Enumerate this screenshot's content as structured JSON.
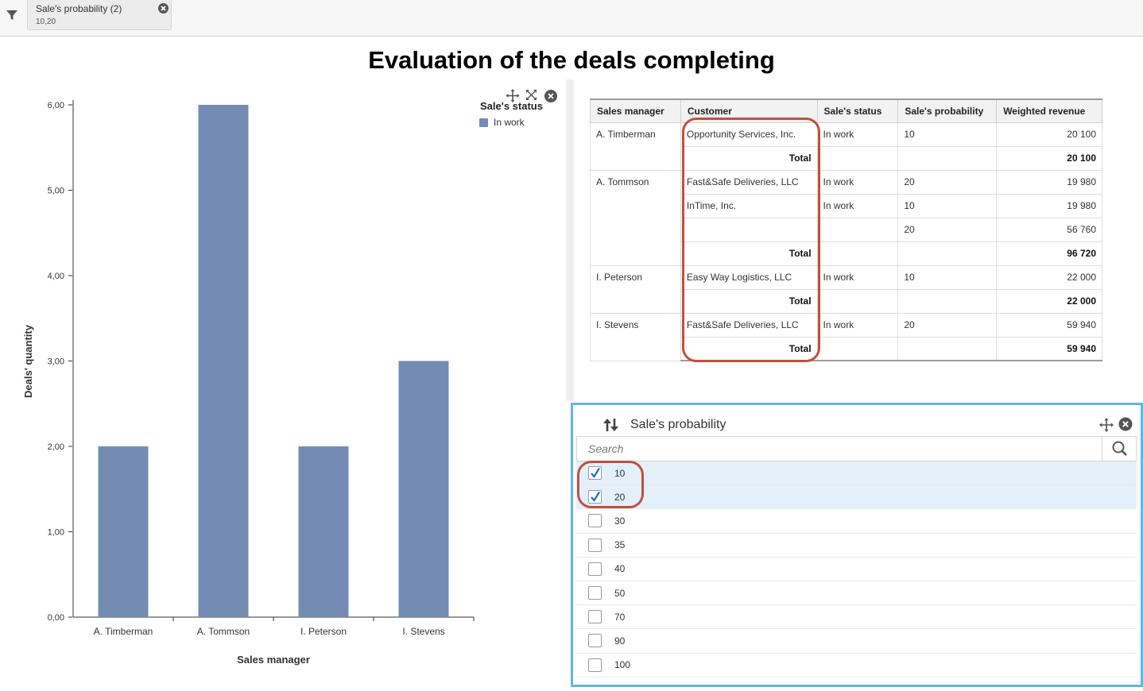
{
  "filter_bar": {
    "chip_title": "Sale's probability (2)",
    "chip_value": "10,20"
  },
  "page_title": "Evaluation of the deals completing",
  "chart_data": {
    "type": "bar",
    "categories": [
      "A. Timberman",
      "A. Tommson",
      "I. Peterson",
      "I. Stevens"
    ],
    "series": [
      {
        "name": "In work",
        "values": [
          2,
          6,
          2,
          3
        ],
        "color": "#748cb3"
      }
    ],
    "xlabel": "Sales manager",
    "ylabel": "Deals' quantity",
    "ylim": [
      0,
      6
    ],
    "yticks": [
      "0,00",
      "1,00",
      "2,00",
      "3,00",
      "4,00",
      "5,00",
      "6,00"
    ],
    "legend_title": "Sale's status",
    "legend_position": "top-right",
    "grid": false
  },
  "pivot": {
    "headers": [
      "Sales manager",
      "Customer",
      "Sale's status",
      "Sale's probability",
      "Weighted revenue"
    ],
    "groups": [
      {
        "manager": "A. Timberman",
        "rows": [
          {
            "customer": "Opportunity Services, Inc.",
            "status": "In work",
            "probability": "10",
            "revenue": "20 100"
          }
        ],
        "total_label": "Total",
        "total": "20 100"
      },
      {
        "manager": "A. Tommson",
        "rows": [
          {
            "customer": "Fast&Safe Deliveries, LLC",
            "status": "In work",
            "probability": "20",
            "revenue": "19 980"
          },
          {
            "customer": "InTime, Inc.",
            "status": "In work",
            "probability": "10",
            "revenue": "19 980"
          },
          {
            "customer": "",
            "status": "",
            "probability": "20",
            "revenue": "56 760"
          }
        ],
        "total_label": "Total",
        "total": "96 720"
      },
      {
        "manager": "I. Peterson",
        "rows": [
          {
            "customer": "Easy Way Logistics, LLC",
            "status": "In work",
            "probability": "10",
            "revenue": "22 000"
          }
        ],
        "total_label": "Total",
        "total": "22 000"
      },
      {
        "manager": "I. Stevens",
        "rows": [
          {
            "customer": "Fast&Safe Deliveries, LLC",
            "status": "In work",
            "probability": "20",
            "revenue": "59 940"
          }
        ],
        "total_label": "Total",
        "total": "59 940"
      }
    ]
  },
  "filter_panel": {
    "title": "Sale's probability",
    "search_placeholder": "Search",
    "options": [
      {
        "label": "10",
        "checked": true
      },
      {
        "label": "20",
        "checked": true
      },
      {
        "label": "30",
        "checked": false
      },
      {
        "label": "35",
        "checked": false
      },
      {
        "label": "40",
        "checked": false
      },
      {
        "label": "50",
        "checked": false
      },
      {
        "label": "70",
        "checked": false
      },
      {
        "label": "90",
        "checked": false
      },
      {
        "label": "100",
        "checked": false
      }
    ]
  },
  "colors": {
    "accent": "#60b6de",
    "annotation": "#c0503e",
    "bar": "#748cb3",
    "selected_row": "#e3eff9"
  }
}
